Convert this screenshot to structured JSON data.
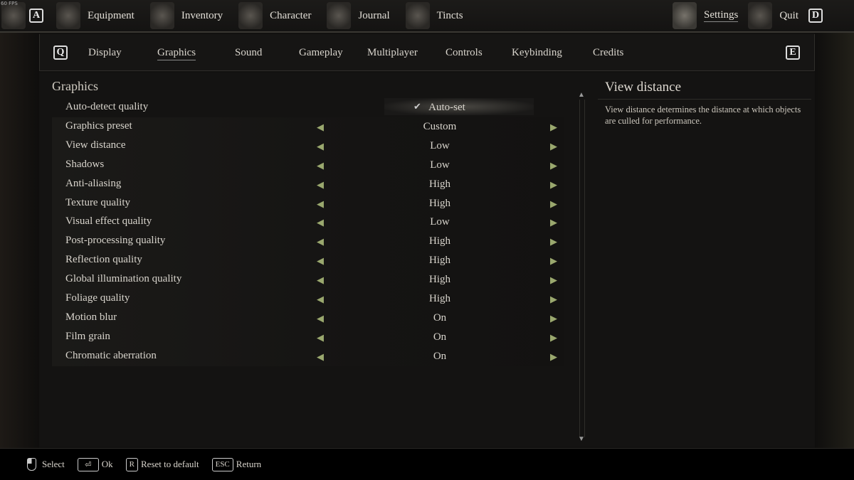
{
  "fps": "60 FPS",
  "top_nav": {
    "left_key": "A",
    "right_key": "D",
    "items": [
      {
        "label": "Equipment",
        "icon": "equipment-icon"
      },
      {
        "label": "Inventory",
        "icon": "inventory-icon"
      },
      {
        "label": "Character",
        "icon": "character-icon"
      },
      {
        "label": "Journal",
        "icon": "journal-icon"
      },
      {
        "label": "Tincts",
        "icon": "tincts-icon"
      }
    ],
    "settings": "Settings",
    "quit": "Quit"
  },
  "sub_tabs": {
    "left_key": "Q",
    "right_key": "E",
    "active": "Graphics",
    "items": [
      "Display",
      "Graphics",
      "Sound",
      "Gameplay",
      "Multiplayer",
      "Controls",
      "Keybinding",
      "Credits"
    ]
  },
  "section_title": "Graphics",
  "settings": [
    {
      "label": "Auto-detect quality",
      "value": "Auto-set"
    },
    {
      "label": "Graphics preset",
      "value": "Custom"
    },
    {
      "label": "View distance",
      "value": "Low"
    },
    {
      "label": "Shadows",
      "value": "Low"
    },
    {
      "label": "Anti-aliasing",
      "value": "High"
    },
    {
      "label": "Texture quality",
      "value": "High"
    },
    {
      "label": "Visual effect quality",
      "value": "Low"
    },
    {
      "label": "Post-processing quality",
      "value": "High"
    },
    {
      "label": "Reflection quality",
      "value": "High"
    },
    {
      "label": "Global illumination quality",
      "value": "High"
    },
    {
      "label": "Foliage quality",
      "value": "High"
    },
    {
      "label": "Motion blur",
      "value": "On"
    },
    {
      "label": "Film grain",
      "value": "On"
    },
    {
      "label": "Chromatic aberration",
      "value": "On"
    }
  ],
  "description": {
    "title": "View distance",
    "text": "View distance determines the distance at which objects are culled for performance."
  },
  "footer": [
    {
      "key": "mouse",
      "label": "Select"
    },
    {
      "key": "⏎",
      "label": "Ok"
    },
    {
      "key": "R",
      "label": "Reset to default"
    },
    {
      "key": "ESC",
      "label": "Return"
    }
  ],
  "colors": {
    "arrow": "#9aa86e",
    "background": "#141312"
  }
}
